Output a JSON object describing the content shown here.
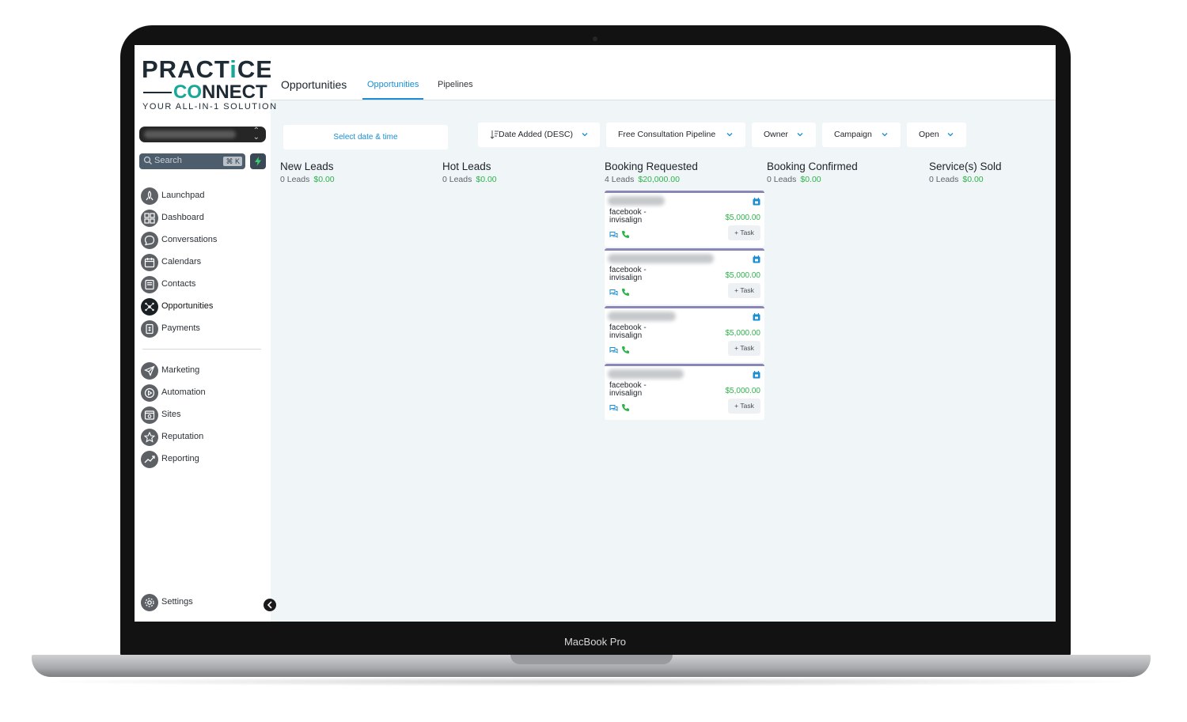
{
  "device": {
    "label": "MacBook Pro"
  },
  "logo": {
    "line1_a": "PRACT",
    "line1_i": "i",
    "line1_b": "CE",
    "line2_a": "CO",
    "line2_b": "NNECT",
    "tagline": "YOUR ALL-IN-1 SOLUTION"
  },
  "sidebar": {
    "search_placeholder": "Search",
    "search_shortcut": "⌘ K",
    "nav": [
      {
        "label": "Launchpad",
        "icon": "launchpad-icon"
      },
      {
        "label": "Dashboard",
        "icon": "dashboard-icon"
      },
      {
        "label": "Conversations",
        "icon": "conversations-icon"
      },
      {
        "label": "Calendars",
        "icon": "calendar-icon"
      },
      {
        "label": "Contacts",
        "icon": "contacts-icon"
      },
      {
        "label": "Opportunities",
        "icon": "opportunities-icon",
        "active": true
      },
      {
        "label": "Payments",
        "icon": "payments-icon"
      }
    ],
    "nav2": [
      {
        "label": "Marketing",
        "icon": "marketing-icon"
      },
      {
        "label": "Automation",
        "icon": "automation-icon"
      },
      {
        "label": "Sites",
        "icon": "sites-icon"
      },
      {
        "label": "Reputation",
        "icon": "reputation-icon"
      },
      {
        "label": "Reporting",
        "icon": "reporting-icon"
      }
    ],
    "settings": {
      "label": "Settings",
      "icon": "settings-icon"
    }
  },
  "header": {
    "title": "Opportunities",
    "tabs": [
      {
        "label": "Opportunities",
        "active": true
      },
      {
        "label": "Pipelines"
      }
    ]
  },
  "filters": {
    "date": "Select date & time",
    "sort": "Date Added (DESC)",
    "pipeline": "Free Consultation Pipeline",
    "owner": "Owner",
    "campaign": "Campaign",
    "status": "Open"
  },
  "columns": [
    {
      "title": "New Leads",
      "count": "0 Leads",
      "amount": "$0.00"
    },
    {
      "title": "Hot Leads",
      "count": "0 Leads",
      "amount": "$0.00"
    },
    {
      "title": "Booking Requested",
      "count": "4 Leads",
      "amount": "$20,000.00"
    },
    {
      "title": "Booking Confirmed",
      "count": "0 Leads",
      "amount": "$0.00"
    },
    {
      "title": "Service(s) Sold",
      "count": "0 Leads",
      "amount": "$0.00"
    }
  ],
  "cards": [
    {
      "source": "facebook - invisalign",
      "amount": "$5,000.00",
      "task": "+ Task"
    },
    {
      "source": "facebook - invisalign",
      "amount": "$5,000.00",
      "task": "+ Task"
    },
    {
      "source": "facebook - invisalign",
      "amount": "$5,000.00",
      "task": "+ Task"
    },
    {
      "source": "facebook - invisalign",
      "amount": "$5,000.00",
      "task": "+ Task"
    }
  ],
  "colors": {
    "accent": "#1a8ed0",
    "money": "#2db34a",
    "card_top": "#8a86b7",
    "brand_teal": "#17a89a"
  }
}
